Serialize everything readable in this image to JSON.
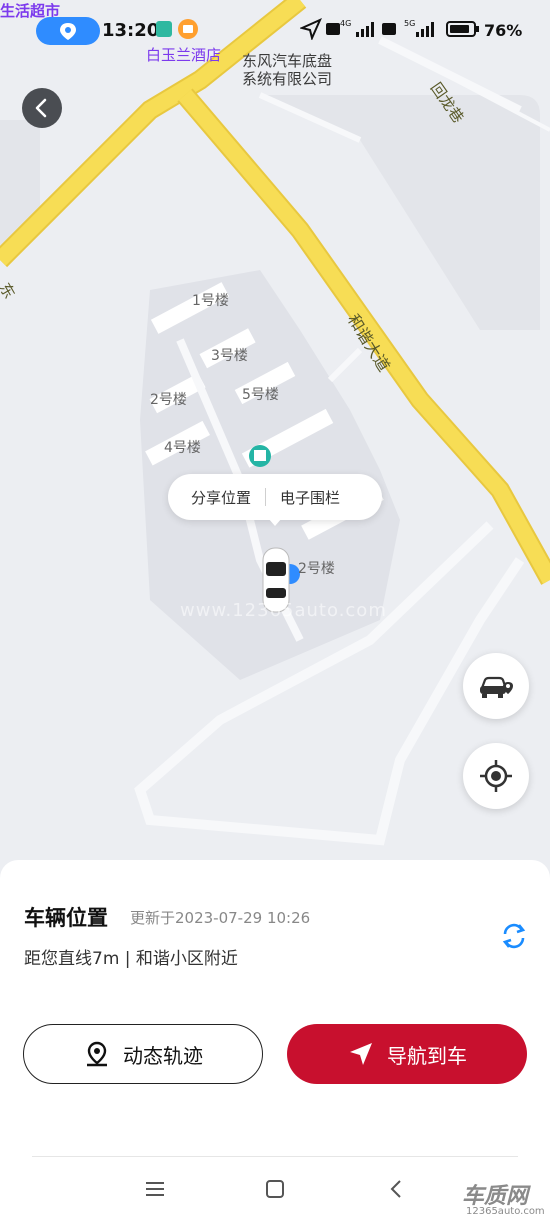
{
  "status_bar": {
    "time": "13:20",
    "battery": "76%",
    "store_label": "生活超市",
    "network_1": "4G",
    "network_2": "5G"
  },
  "map": {
    "poi_hotel": "白玉兰酒店",
    "poi_company_line1": "东风汽车底盘",
    "poi_company_line2": "系统有限公司",
    "road_hualong": "回龙巷",
    "road_hexie": "和谐大道",
    "road_fragment": "东",
    "buildings": [
      "1号楼",
      "3号楼",
      "2号楼",
      "5号楼",
      "4号楼",
      "2号楼"
    ],
    "watermark": "www.12365auto.com"
  },
  "popup": {
    "share_label": "分享位置",
    "fence_label": "电子围栏"
  },
  "sheet": {
    "title": "车辆位置",
    "updated": "更新于2023-07-29 10:26",
    "distance": "距您直线7m | 和谐小区附近",
    "track_button": "动态轨迹",
    "navigate_button": "导航到车"
  },
  "corner_logo": {
    "text": "车质网",
    "url": "12365auto.com"
  },
  "colors": {
    "accent_red": "#c8102e",
    "road_yellow": "#f5d84a",
    "map_bg": "#eceef2",
    "refresh_blue": "#1a8cff"
  }
}
